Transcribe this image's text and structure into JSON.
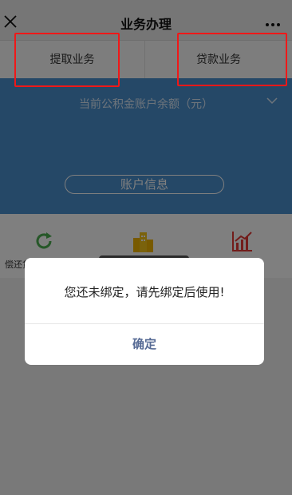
{
  "header": {
    "title": "业务办理",
    "close_icon": "close-icon",
    "more_icon": "more-dots-icon"
  },
  "tabs": [
    {
      "label": "提取业务"
    },
    {
      "label": "贷款业务"
    }
  ],
  "hero": {
    "balance_label": "当前公积金账户余额（元）",
    "account_button": "账户信息"
  },
  "services": {
    "item1_label": "偿还贷",
    "icons": [
      "refresh-icon",
      "buildings-icon",
      "chart-icon"
    ]
  },
  "dialog": {
    "message": "您还未绑定，请先绑定后使用!",
    "confirm_label": "确定"
  },
  "colors": {
    "hero_blue": "#4a90cf",
    "highlight_red": "#f01818",
    "dialog_button": "#576b95"
  }
}
